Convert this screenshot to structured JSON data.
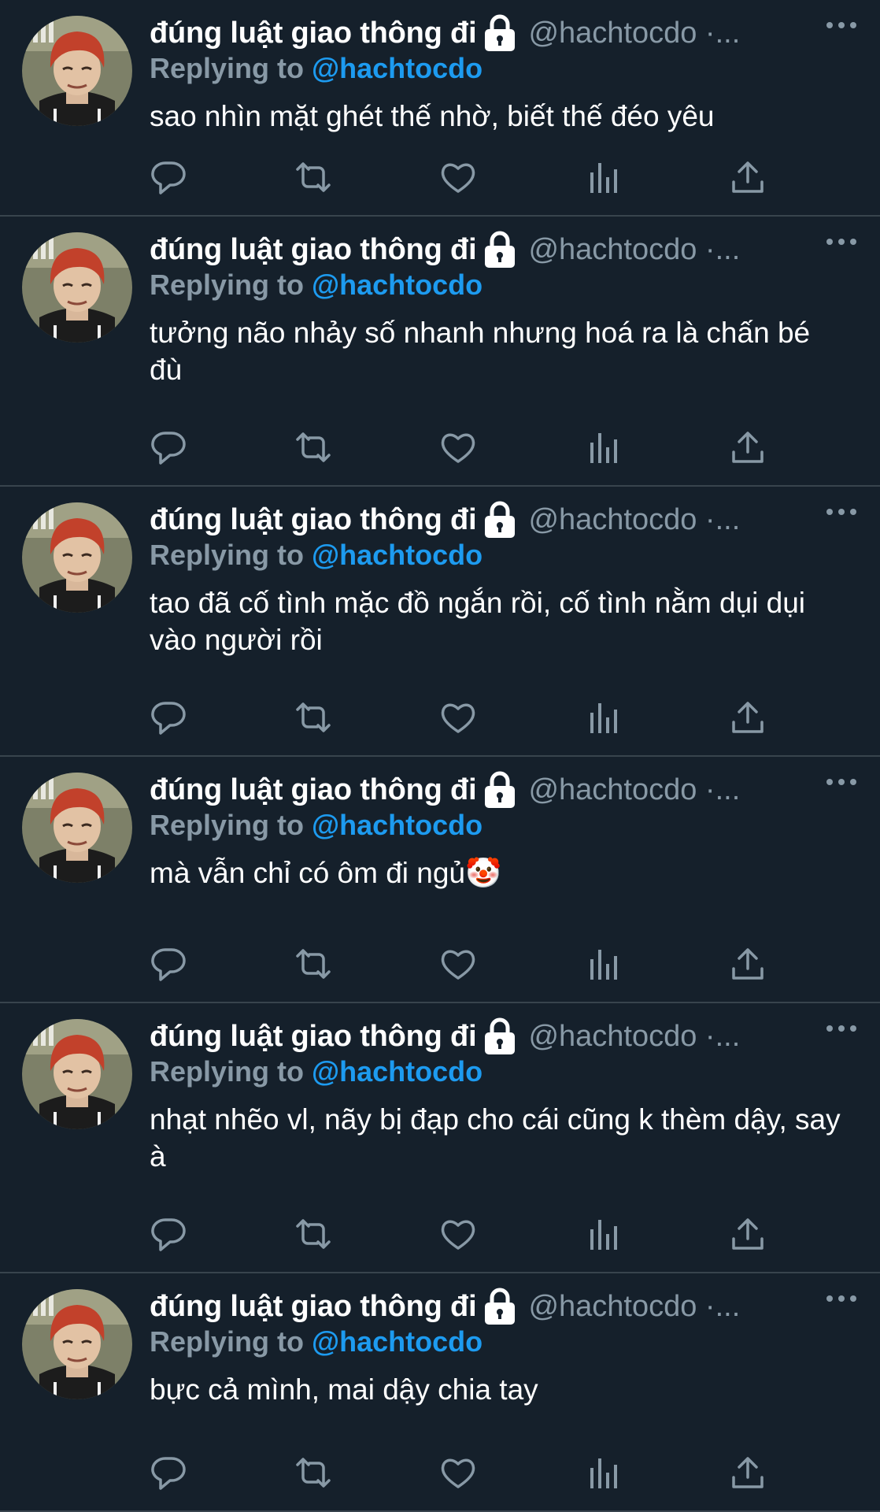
{
  "tweets": [
    {
      "author": {
        "name": "đúng luật giao thông đi",
        "handle": "@hachtocdo ·..."
      },
      "replying_prefix": "Replying to",
      "replying_to": "@hachtocdo",
      "text": "sao nhìn mặt ghét thế nhờ, biết thế đéo yêu"
    },
    {
      "author": {
        "name": "đúng luật giao thông đi",
        "handle": "@hachtocdo ·..."
      },
      "replying_prefix": "Replying to",
      "replying_to": "@hachtocdo",
      "text": "tưởng não nhảy số nhanh nhưng hoá ra là chấn bé đù"
    },
    {
      "author": {
        "name": "đúng luật giao thông đi",
        "handle": "@hachtocdo ·..."
      },
      "replying_prefix": "Replying to",
      "replying_to": "@hachtocdo",
      "text": "tao đã cố tình mặc đồ ngắn rồi, cố tình nằm dụi dụi vào người rồi"
    },
    {
      "author": {
        "name": "đúng luật giao thông đi",
        "handle": "@hachtocdo ·..."
      },
      "replying_prefix": "Replying to",
      "replying_to": "@hachtocdo",
      "text": "mà vẫn chỉ có ôm đi ngủ🤡"
    },
    {
      "author": {
        "name": "đúng luật giao thông đi",
        "handle": "@hachtocdo ·..."
      },
      "replying_prefix": "Replying to",
      "replying_to": "@hachtocdo",
      "text": "nhạt nhẽo vl, nãy bị đạp cho cái cũng k thèm dậy, say à"
    },
    {
      "author": {
        "name": "đúng luật giao thông đi",
        "handle": "@hachtocdo ·..."
      },
      "replying_prefix": "Replying to",
      "replying_to": "@hachtocdo",
      "text": "bực cả mình, mai dậy chia tay"
    }
  ],
  "icons": {
    "avatar": "avatar-photo",
    "protected": "lock-icon",
    "more": "more-icon",
    "reply": "reply-icon",
    "retweet": "retweet-icon",
    "like": "like-icon",
    "views": "views-icon",
    "share": "share-icon"
  },
  "colors": {
    "background": "#15202b",
    "divider": "#38444d",
    "text_primary": "#ffffff",
    "text_secondary": "#8899a6",
    "accent": "#1d9bf0"
  }
}
